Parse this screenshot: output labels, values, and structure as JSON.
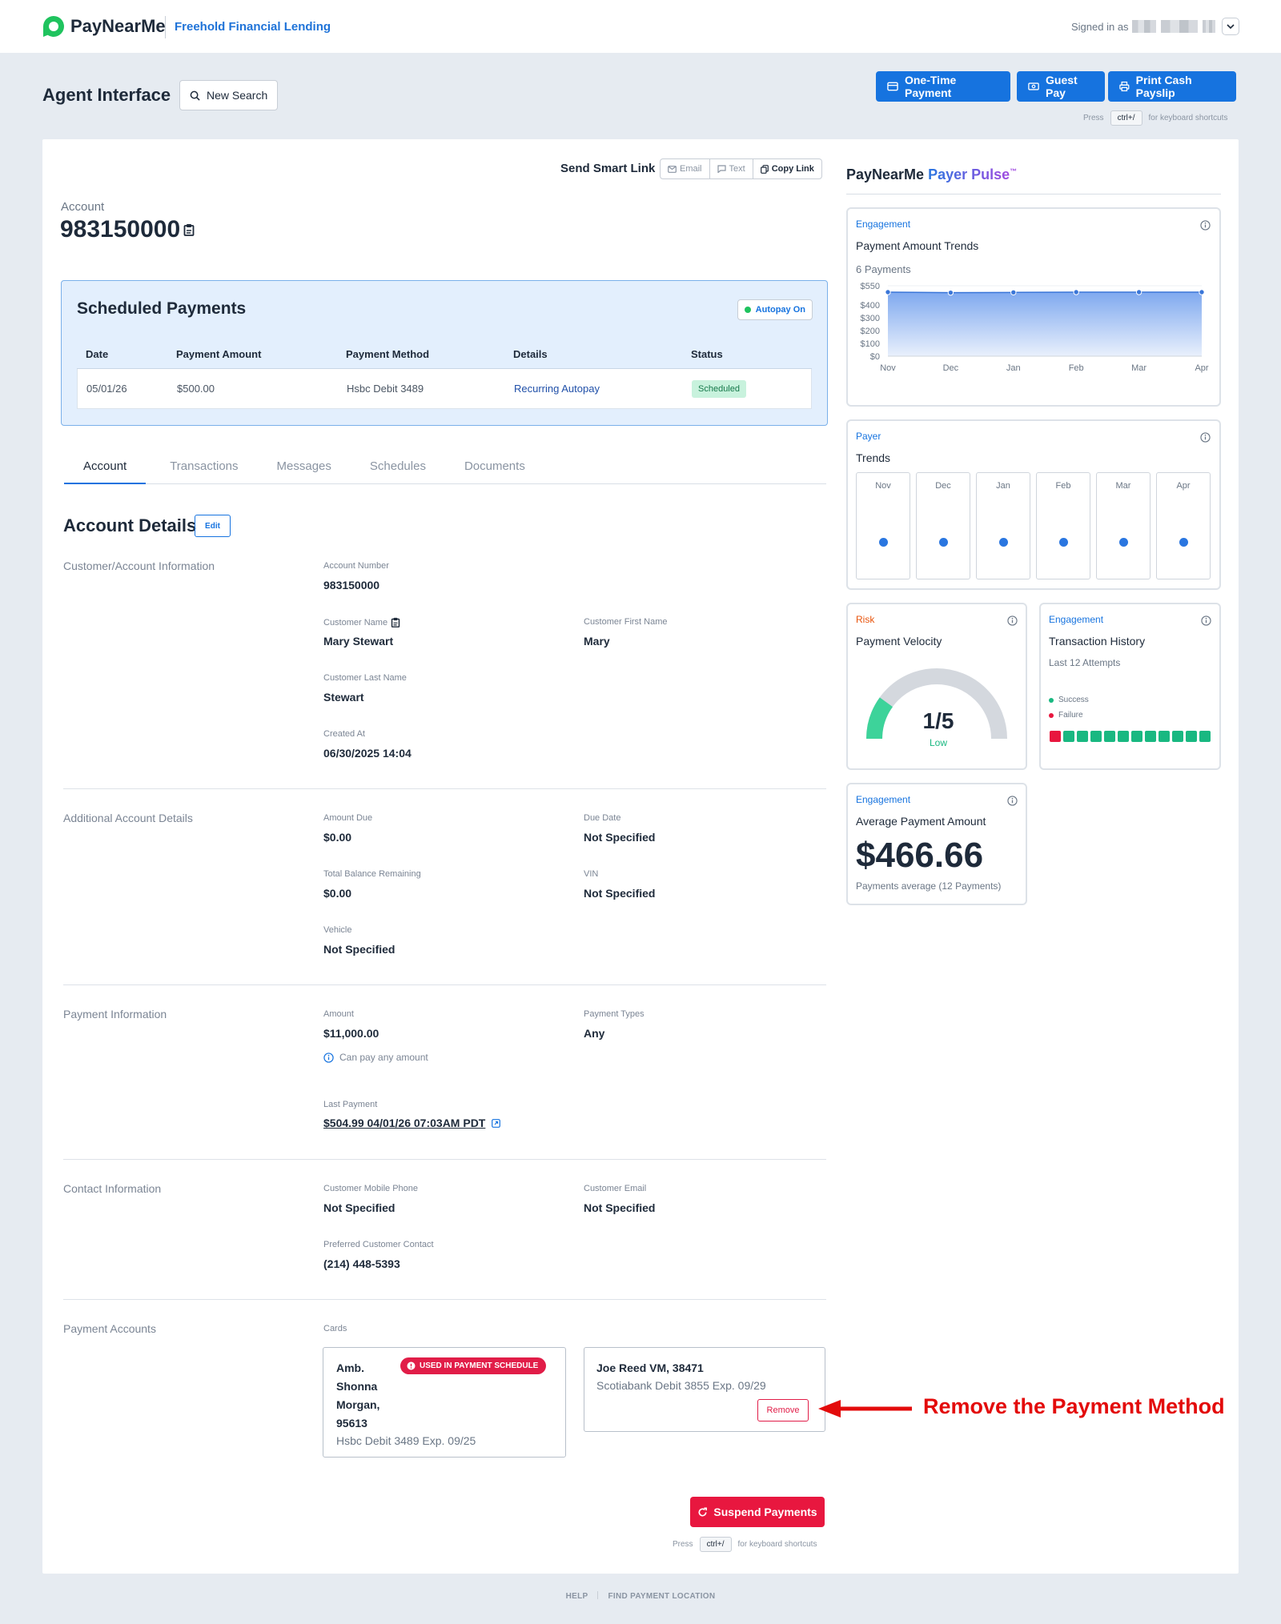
{
  "header": {
    "brand": "PayNearMe",
    "org_name": "Freehold Financial Lending",
    "signed_in_label": "Signed in as"
  },
  "toolbar": {
    "page_title": "Agent Interface",
    "new_search": "New Search",
    "one_time_payment": "One-Time Payment",
    "guest_pay": "Guest Pay",
    "print_cash_payslip": "Print Cash Payslip",
    "hint_press": "Press",
    "hint_key": "ctrl+/",
    "hint_suffix": "for keyboard shortcuts"
  },
  "smart_link": {
    "label": "Send Smart Link",
    "email": "Email",
    "text": "Text",
    "copy": "Copy Link"
  },
  "account": {
    "label": "Account",
    "number": "983150000"
  },
  "scheduled": {
    "title": "Scheduled Payments",
    "autopay": "Autopay On",
    "headers": [
      "Date",
      "Payment Amount",
      "Payment Method",
      "Details",
      "Status"
    ],
    "rows": [
      {
        "date": "05/01/26",
        "amount": "$500.00",
        "method": "Hsbc Debit 3489",
        "details": "Recurring Autopay",
        "status": "Scheduled"
      }
    ]
  },
  "tabs": [
    "Account",
    "Transactions",
    "Messages",
    "Schedules",
    "Documents"
  ],
  "details": {
    "title": "Account Details",
    "edit": "Edit",
    "customer": {
      "group": "Customer/Account Information",
      "account_number_label": "Account Number",
      "account_number": "983150000",
      "customer_name_label": "Customer Name",
      "customer_name": "Mary Stewart",
      "first_name_label": "Customer First Name",
      "first_name": "Mary",
      "last_name_label": "Customer Last Name",
      "last_name": "Stewart",
      "created_label": "Created At",
      "created": "06/30/2025 14:04"
    },
    "additional": {
      "group": "Additional Account Details",
      "amount_due_label": "Amount Due",
      "amount_due": "$0.00",
      "due_date_label": "Due Date",
      "due_date": "Not Specified",
      "balance_label": "Total Balance Remaining",
      "balance": "$0.00",
      "vin_label": "VIN",
      "vin": "Not Specified",
      "vehicle_label": "Vehicle",
      "vehicle": "Not Specified"
    },
    "payment": {
      "group": "Payment Information",
      "amount_label": "Amount",
      "amount": "$11,000.00",
      "types_label": "Payment Types",
      "types": "Any",
      "any_amount_note": "Can pay any amount",
      "last_payment_label": "Last Payment",
      "last_payment": "$504.99 04/01/26 07:03AM PDT"
    },
    "contact": {
      "group": "Contact Information",
      "mobile_label": "Customer Mobile Phone",
      "mobile": "Not Specified",
      "email_label": "Customer Email",
      "email": "Not Specified",
      "preferred_label": "Preferred Customer Contact",
      "preferred": "(214) 448-5393"
    },
    "payment_accounts": {
      "group": "Payment Accounts",
      "cards_label": "Cards",
      "cards": [
        {
          "name_lines": [
            "Amb.",
            "Shonna",
            "Morgan,",
            "95613"
          ],
          "desc": "Hsbc Debit 3489 Exp. 09/25",
          "badge": "USED IN PAYMENT SCHEDULE"
        },
        {
          "name": "Joe Reed VM, 38471",
          "desc": "Scotiabank Debit 3855 Exp. 09/29",
          "action": "Remove"
        }
      ]
    }
  },
  "suspend": "Suspend Payments",
  "annotation": "Remove the Payment Method",
  "footer": {
    "help": "HELP",
    "find": "FIND PAYMENT LOCATION"
  },
  "pulse": {
    "brand": "PayNearMe",
    "product": "Payer Pulse",
    "tm": "™",
    "trends": {
      "category": "Engagement",
      "title": "Payment Amount Trends",
      "subtitle": "6 Payments"
    },
    "payer": {
      "category": "Payer",
      "title": "Trends",
      "months": [
        "Nov",
        "Dec",
        "Jan",
        "Feb",
        "Mar",
        "Apr"
      ]
    },
    "velocity": {
      "category": "Risk",
      "title": "Payment Velocity",
      "value": "1/5",
      "level": "Low",
      "fraction": 0.2
    },
    "history": {
      "category": "Engagement",
      "title": "Transaction History",
      "subtitle": "Last 12 Attempts",
      "success": "Success",
      "failure": "Failure",
      "attempts": [
        "failure",
        "success",
        "success",
        "success",
        "success",
        "success",
        "success",
        "success",
        "success",
        "success",
        "success",
        "success"
      ]
    },
    "average": {
      "category": "Engagement",
      "title": "Average Payment Amount",
      "value": "$466.66",
      "subtitle": "Payments average (12 Payments)"
    },
    "colors": {
      "engagement": "#1673df",
      "risk": "#e8540c",
      "success": "#19b881",
      "failure": "#e8173f",
      "gauge": "#3dd39a"
    }
  },
  "chart_data": {
    "type": "area",
    "categories": [
      "Nov",
      "Dec",
      "Jan",
      "Feb",
      "Mar",
      "Apr"
    ],
    "series": [
      {
        "values": [
          500,
          496,
          498,
          500,
          500,
          500
        ]
      }
    ],
    "yticks": [
      "$550",
      "$400",
      "$300",
      "$200",
      "$100",
      "$0"
    ],
    "ylim": [
      0,
      550
    ],
    "grid": true
  }
}
